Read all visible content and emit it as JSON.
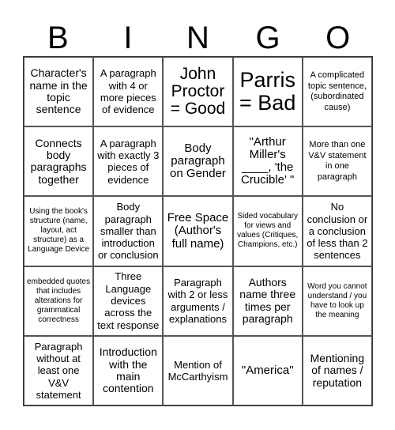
{
  "header": {
    "letters": [
      "B",
      "I",
      "N",
      "G",
      "O"
    ]
  },
  "cells": [
    [
      "Character's name in the topic sentence",
      "A paragraph with 4 or more pieces of evidence",
      "John Proctor = Good",
      "Parris = Bad",
      "A complicated topic sentence, (subordinated cause)"
    ],
    [
      "Connects body paragraphs together",
      "A paragraph with exactly 3 pieces of evidence",
      "Body paragraph on Gender",
      "\"Arthur Miller's ____, 'the Crucible' \"",
      "More than one V&V statement in one paragraph"
    ],
    [
      "Using the book's structure (name, layout, act structure) as a Language Device",
      "Body paragraph smaller than introduction or conclusion",
      "Free Space (Author's full name)",
      "Sided vocabulary for views and values (Critiques, Champions, etc.)",
      "No conclusion or a conclusion of less than 2 sentences"
    ],
    [
      "embedded quotes that includes alterations for grammatical correctness",
      "Three Language devices across the text response",
      "Paragraph with 2 or less arguments / explanations",
      "Authors name three times per paragraph",
      "Word you cannot understand / you have to look up the meaning"
    ],
    [
      "Paragraph without at least one V&V statement",
      "Introduction with the main contention",
      "Mention of McCarthyism",
      "\"America\"",
      "Mentioning of names / reputation"
    ]
  ]
}
